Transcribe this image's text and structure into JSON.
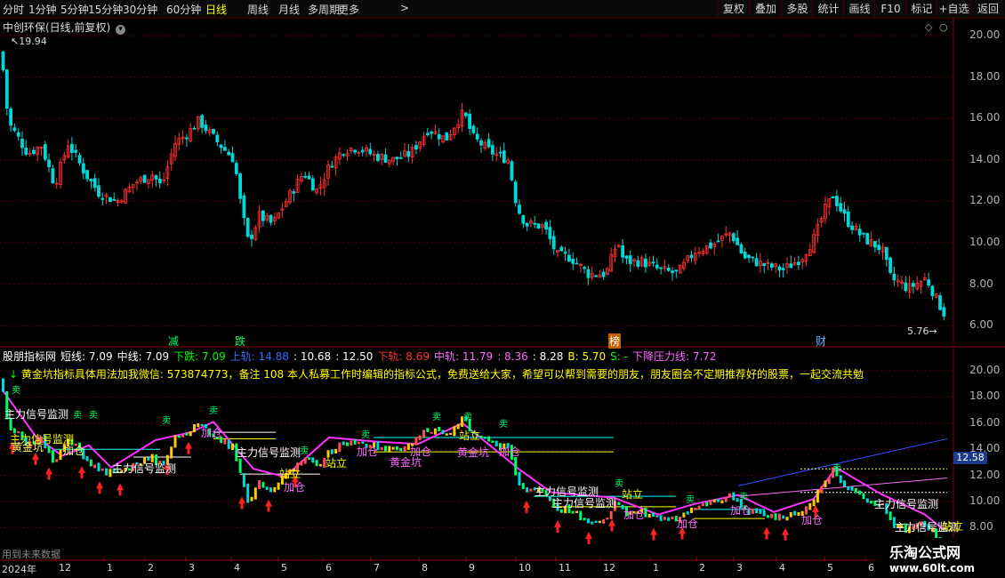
{
  "toolbar": {
    "periods": [
      "分时",
      "1分钟",
      "5分钟",
      "15分钟",
      "30分钟",
      "60分钟",
      "日线",
      "周线",
      "月线",
      "多周期",
      "更多"
    ],
    "active_period": "日线",
    "more_chevron": ">",
    "buttons": [
      "复权",
      "叠加",
      "多股",
      "统计",
      "画线",
      "F10",
      "标记",
      "+自选",
      "返回"
    ]
  },
  "stock": {
    "title": "中创环保(日线,前复权)",
    "price_high_label": "19.94",
    "price_low_label": "5.76"
  },
  "events": [
    {
      "label": "减",
      "color": "#00ff66"
    },
    {
      "label": "跌",
      "color": "#00ff66"
    },
    {
      "label": "榜",
      "color": "#ffffff",
      "bg": "#c06000"
    },
    {
      "label": "财",
      "color": "#6ab0ff"
    }
  ],
  "price_axis": [
    "20.00",
    "18.00",
    "16.00",
    "14.00",
    "12.00",
    "10.00",
    "8.00",
    "6.00"
  ],
  "indicator": {
    "name": "股朋指标网",
    "items": [
      {
        "text": "短线: 7.09",
        "color": "#ffffff"
      },
      {
        "text": "中线: 7.09",
        "color": "#ffffff"
      },
      {
        "text": "下跌: 7.09",
        "color": "#00ff00"
      },
      {
        "text": "上轨: 14.88",
        "color": "#3a6aff"
      },
      {
        "text": ": 10.68",
        "color": "#ffffff"
      },
      {
        "text": ": 12.50",
        "color": "#ffffff"
      },
      {
        "text": "下轨: 8.69",
        "color": "#ff3030"
      },
      {
        "text": "中轨: 11.79",
        "color": "#ff66ff"
      },
      {
        "text": ": 8.36",
        "color": "#ff66ff"
      },
      {
        "text": ": 8.28",
        "color": "#ffffff"
      },
      {
        "text": "B: 5.70",
        "color": "#ffff00"
      },
      {
        "text": "S: -",
        "color": "#00ff00"
      },
      {
        "text": "下降压力线: 7.72",
        "color": "#ff66ff"
      }
    ],
    "note": "黄金坑指标具体用法加我微信: 573874773，备注 108 本人私募工作时编辑的指标公式，免费送给大家，希望可以帮到需要的朋友，朋友圈会不定期推荐好的股票，一起交流共勉",
    "axis": [
      "20.00",
      "18.00",
      "16.00",
      "14.00",
      "12.00",
      "10.00",
      "8.00"
    ],
    "current_value": "12.58",
    "future_data_label": "用到未来数据",
    "annotations": {
      "signal": "主力信号监测",
      "sell": "卖",
      "add": "加仓",
      "buy": "买",
      "pit": "黄金坑",
      "stand": "站立"
    }
  },
  "x_axis": {
    "year": "2024年",
    "months": [
      "12",
      "1",
      "2",
      "3",
      "4",
      "5",
      "6",
      "7",
      "8",
      "9",
      "10",
      "11",
      "12",
      "1",
      "2",
      "3",
      "4",
      "5",
      "6"
    ]
  },
  "watermark": {
    "line1": "乐淘公式网",
    "line2": "www.60lt.com"
  },
  "colors": {
    "up": "#ff3030",
    "down": "#00d8d8",
    "accent": "#ffff00",
    "pink": "#ff33ff"
  }
}
